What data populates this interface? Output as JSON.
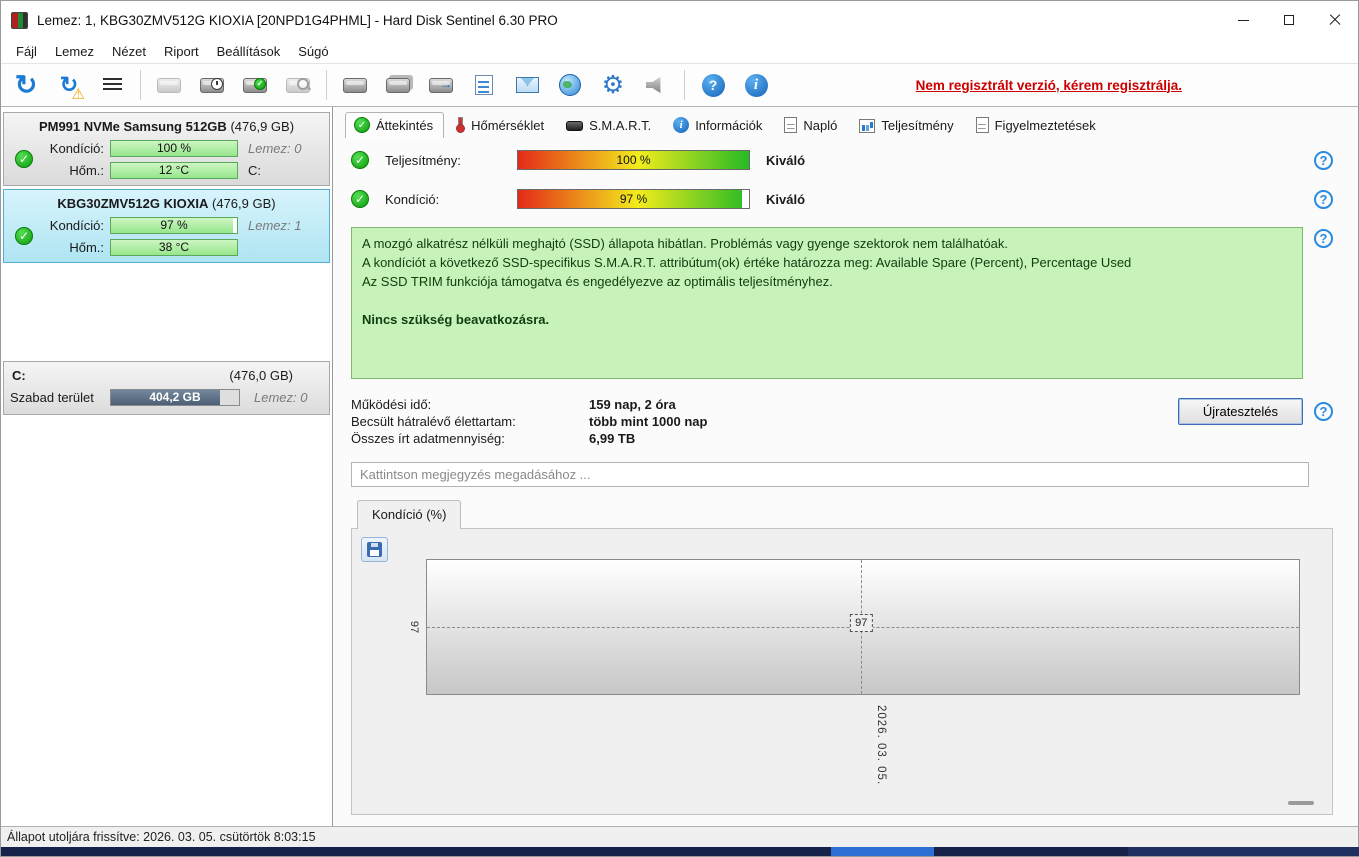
{
  "window": {
    "title": "Lemez: 1, KBG30ZMV512G KIOXIA [20NPD1G4PHML]  -  Hard Disk Sentinel 6.30 PRO"
  },
  "menu": {
    "items": [
      "Fájl",
      "Lemez",
      "Nézet",
      "Riport",
      "Beállítások",
      "Súgó"
    ]
  },
  "toolbar": {
    "icons": [
      "refresh-icon",
      "refresh-warning-icon",
      "report-lines-icon",
      "disk-icon",
      "disk-clock-icon",
      "disk-accept-icon",
      "disk-search-icon",
      "disk-plain-icon",
      "disk-stack-icon",
      "disk-arrow-icon",
      "notes-icon",
      "mail-icon",
      "network-globe-icon",
      "settings-gear-icon",
      "sound-icon",
      "help-icon",
      "info-icon"
    ],
    "register_text": "Nem regisztrált verzió, kérem regisztrálja."
  },
  "sidebar": {
    "disks": [
      {
        "name": "PM991 NVMe Samsung 512GB",
        "size": "(476,9 GB)",
        "condition_label": "Kondíció:",
        "condition_value": "100 %",
        "condition_percent": 100,
        "disk_no": "Lemez: 0",
        "temp_label": "Hőm.:",
        "temp_value": "12 °C",
        "temp_percent": 100,
        "drive_letter": "C:"
      },
      {
        "name": "KBG30ZMV512G KIOXIA",
        "size": "(476,9 GB)",
        "condition_label": "Kondíció:",
        "condition_value": "97 %",
        "condition_percent": 97,
        "disk_no": "Lemez: 1",
        "temp_label": "Hőm.:",
        "temp_value": "38 °C",
        "temp_percent": 100,
        "drive_letter": ""
      }
    ],
    "partition": {
      "letter": "C:",
      "size": "(476,0 GB)",
      "free_label": "Szabad terület",
      "free_value": "404,2 GB",
      "free_percent": 85,
      "disk_no": "Lemez: 0"
    }
  },
  "tabs": [
    {
      "label": "Áttekintés"
    },
    {
      "label": "Hőmérséklet"
    },
    {
      "label": "S.M.A.R.T."
    },
    {
      "label": "Információk"
    },
    {
      "label": "Napló"
    },
    {
      "label": "Teljesítmény"
    },
    {
      "label": "Figyelmeztetések"
    }
  ],
  "overview": {
    "performance_label": "Teljesítmény:",
    "performance_value": "100 %",
    "performance_percent": 100,
    "performance_rating": "Kiváló",
    "condition_label": "Kondíció:",
    "condition_value": "97 %",
    "condition_percent": 97,
    "condition_rating": "Kiváló",
    "status_lines": [
      "A mozgó alkatrész nélküli meghajtó (SSD) állapota hibátlan. Problémás vagy gyenge szektorok nem találhatóak.",
      "A kondíciót a következő SSD-specifikus S.M.A.R.T. attribútum(ok) értéke határozza meg:  Available Spare (Percent), Percentage Used",
      "Az SSD TRIM funkciója támogatva és engedélyezve az optimális teljesítményhez."
    ],
    "status_bold": "Nincs szükség beavatkozásra.",
    "stats": [
      {
        "label": "Működési idő:",
        "value": "159 nap, 2 óra"
      },
      {
        "label": "Becsült hátralévő élettartam:",
        "value": "több mint 1000 nap"
      },
      {
        "label": "Összes írt adatmennyiség:",
        "value": "6,99 TB"
      }
    ],
    "retest_button": "Újratesztelés",
    "comment_placeholder": "Kattintson megjegyzés megadásához ..."
  },
  "chart": {
    "tab_label": "Kondíció  (%)",
    "axis_value": "97",
    "point_label": "97",
    "x_label": "2026. 03. 05."
  },
  "chart_data": {
    "type": "line",
    "title": "Kondíció (%)",
    "x": [
      "2026. 03. 05."
    ],
    "values": [
      97
    ],
    "ylim": [
      0,
      100
    ],
    "grid": "dashed-crosshair",
    "annotations": [
      "97"
    ]
  },
  "statusbar": {
    "text": "Állapot utoljára frissítve: 2026. 03. 05. csütörtök 8:03:15"
  }
}
